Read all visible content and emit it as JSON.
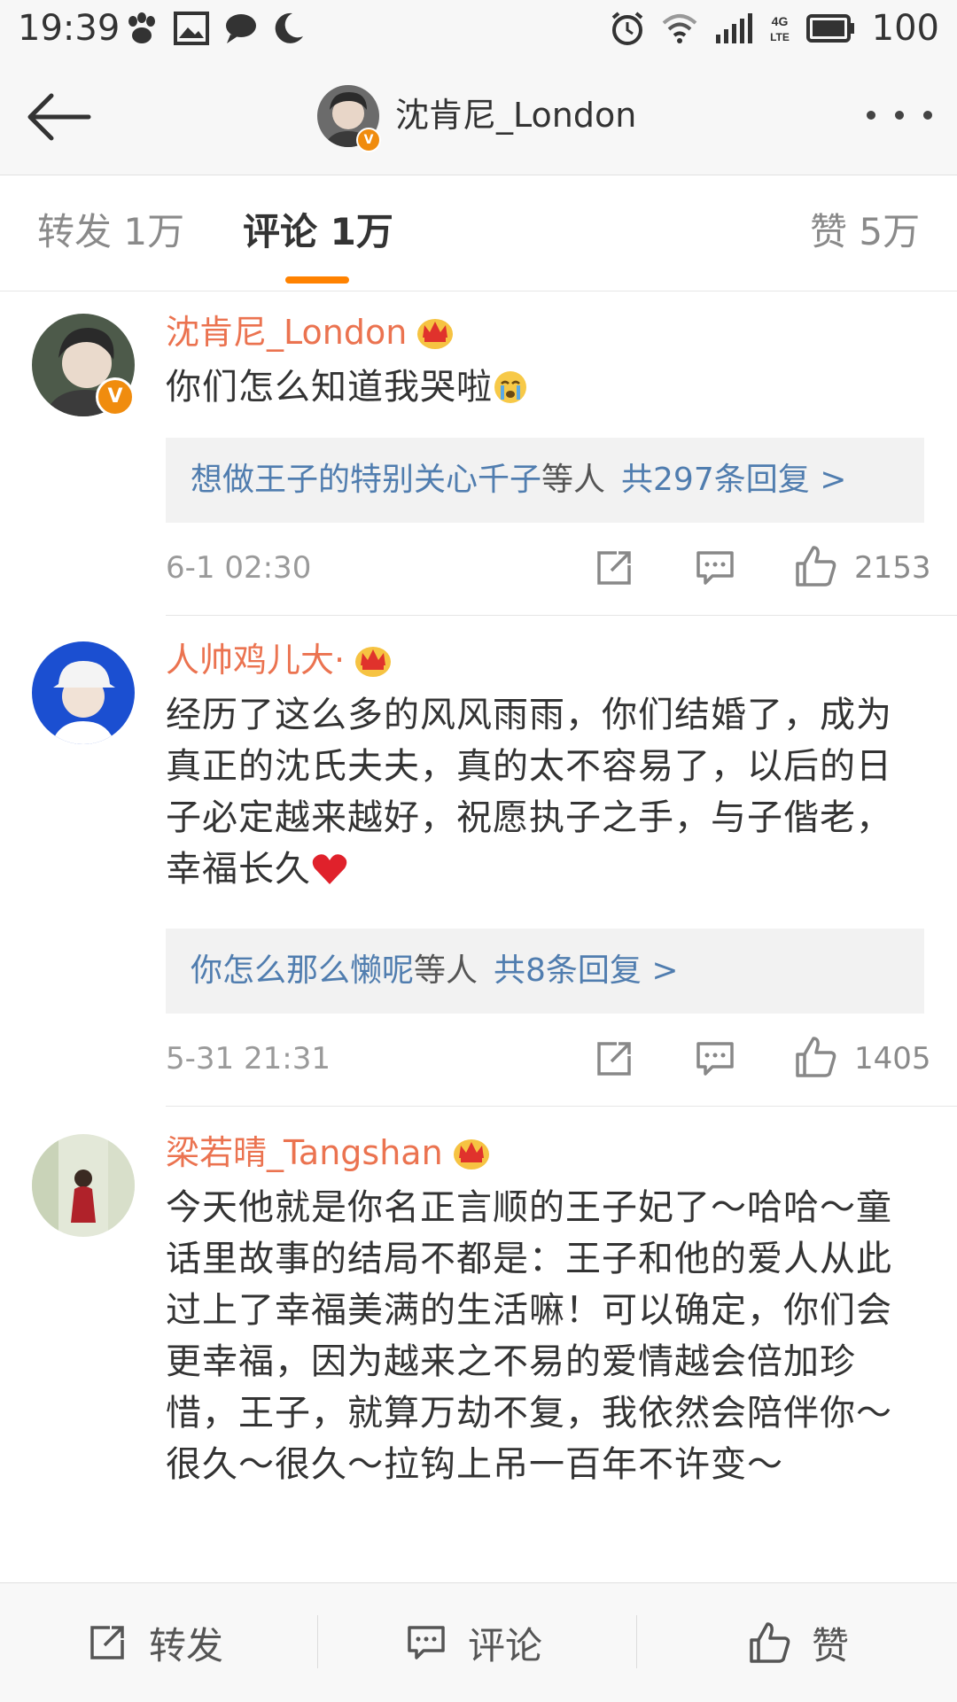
{
  "status_bar": {
    "time": "19:39",
    "battery": "100",
    "left_icons": [
      "baidu-paw-icon",
      "image-icon",
      "chat-bubble-icon",
      "moon-icon"
    ],
    "right_icons": [
      "alarm-icon",
      "wifi-icon",
      "signal-icon",
      "4g-lte-icon",
      "battery-icon"
    ]
  },
  "nav": {
    "title": "沈肯尼_London",
    "back_icon": "back-arrow-icon",
    "more_icon": "more-dots-icon"
  },
  "tabs": [
    {
      "label": "转发 1万",
      "active": false
    },
    {
      "label": "评论 1万",
      "active": true
    },
    {
      "label": "赞 5万",
      "active": false
    }
  ],
  "accent_color": "#ff8200",
  "username_color": "#eb7350",
  "link_color": "#507daf",
  "comments": [
    {
      "username": "沈肯尼_London",
      "text": "你们怎么知道我哭啦",
      "emoji": "crying-emoji",
      "reply_user": "想做王子的特别关心千子",
      "reply_mid": "等人",
      "reply_count": "共297条回复 >",
      "time": "6-1 02:30",
      "likes": "2153"
    },
    {
      "username": "人帅鸡儿大·",
      "text": "经历了这么多的风风雨雨，你们结婚了，成为真正的沈氏夫夫，真的太不容易了，以后的日子必定越来越好，祝愿执子之手，与子偕老，幸福长久",
      "emoji": "heart-emoji",
      "reply_user": "你怎么那么懒呢",
      "reply_mid": "等人",
      "reply_count": "共8条回复 >",
      "time": "5-31 21:31",
      "likes": "1405"
    },
    {
      "username": "梁若晴_Tangshan",
      "text": "今天他就是你名正言顺的王子妃了～哈哈～童话里故事的结局不都是：王子和他的爱人从此过上了幸福美满的生活嘛！可以确定，你们会更幸福，因为越来之不易的爱情越会倍加珍惜，王子，就算万劫不复，我依然会陪伴你～很久～很久～拉钩上吊一百年不许变～"
    }
  ],
  "bottom_bar": {
    "repost_label": "转发",
    "comment_label": "评论",
    "like_label": "赞"
  }
}
